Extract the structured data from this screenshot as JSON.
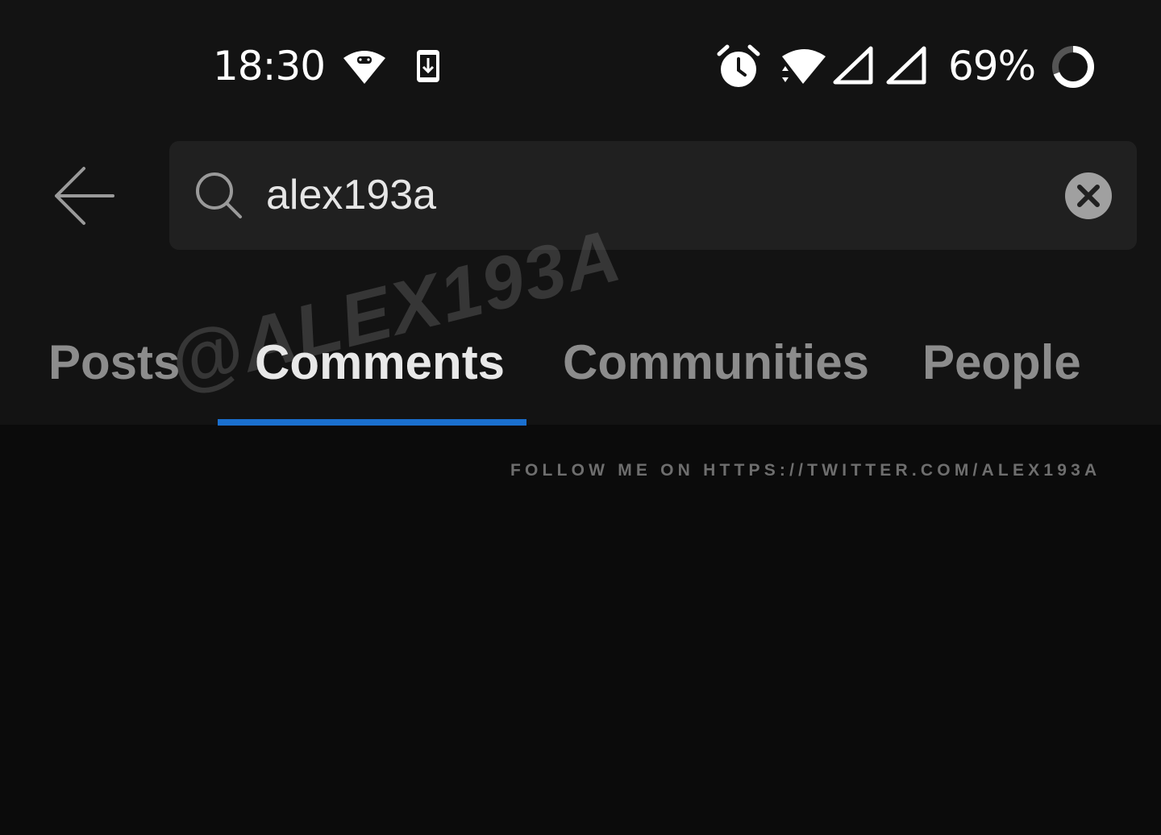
{
  "status_bar": {
    "time": "18:30",
    "battery_percent": "69%",
    "battery_level": 0.69,
    "icons": [
      "android-wifi-icon",
      "download-phone-icon",
      "alarm-icon",
      "wifi-icon",
      "signal-icon",
      "signal-icon",
      "battery-ring-icon"
    ]
  },
  "search": {
    "value": "alex193a",
    "back_icon": "arrow-left-icon",
    "search_icon": "search-icon",
    "clear_icon": "close-circle-icon"
  },
  "tabs": [
    {
      "label": "Posts",
      "active": false
    },
    {
      "label": "Comments",
      "active": true
    },
    {
      "label": "Communities",
      "active": false
    },
    {
      "label": "People",
      "active": false
    }
  ],
  "watermark": {
    "handle": "@ALEX193A",
    "follow_text": "FOLLOW ME ON HTTPS://TWITTER.COM/ALEX193A"
  },
  "colors": {
    "background": "#0b0b0b",
    "header_background": "#131313",
    "search_background": "#202020",
    "tab_indicator": "#1a6fcf",
    "tab_active": "#e8e8e8",
    "tab_inactive": "#8c8c8c"
  }
}
